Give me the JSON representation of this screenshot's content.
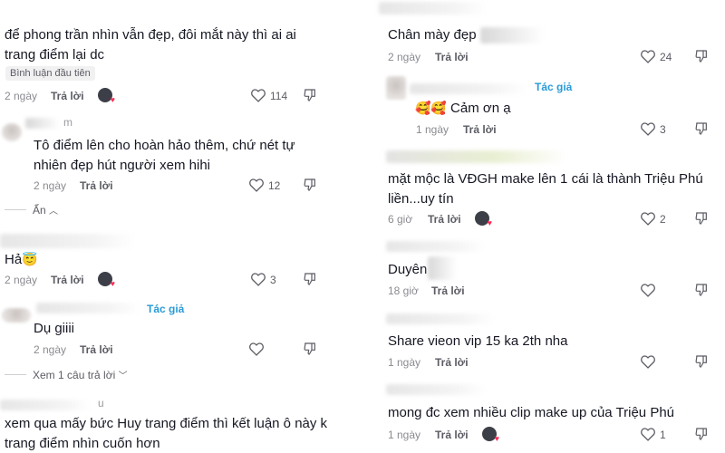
{
  "left": {
    "c1": {
      "text": "để phong trần nhìn vẫn đẹp, đôi mắt này thì ai ai trang điểm lại dc",
      "badge": "Bình luận đầu tiên",
      "time": "2 ngày",
      "reply": "Trả lời",
      "likes": "114"
    },
    "c2": {
      "user_tail": "m",
      "text": "Tô điểm lên cho hoàn hảo thêm, chứ nét tự nhiên đẹp hút người xem hihi",
      "time": "2 ngày",
      "reply": "Trả lời",
      "likes": "12",
      "hide": "Ẩn"
    },
    "c3": {
      "text": "Hả",
      "emoji": "😇",
      "time": "2 ngày",
      "reply": "Trả lời",
      "likes": "3"
    },
    "c4": {
      "author": "Tác giả",
      "text": "Dụ giiii",
      "time": "2 ngày",
      "reply": "Trả lời",
      "view_replies": "Xem 1 câu trả lời"
    },
    "c5": {
      "user_tail": "u",
      "text": "xem qua mấy bức Huy trang điểm thì kết luận ô này k trang điểm nhìn cuốn hơn"
    }
  },
  "right": {
    "c1": {
      "text": "Chân mày đẹp",
      "time": "2 ngày",
      "reply": "Trả lời",
      "likes": "24"
    },
    "c2": {
      "author": "Tác giả",
      "emoji": "🥰🥰",
      "text": "Cảm ơn ạ",
      "time": "1 ngày",
      "reply": "Trả lời",
      "likes": "3"
    },
    "c3": {
      "text": "mặt mộc là VĐGH make lên 1 cái là thành Triệu Phú liền...uy tín",
      "time": "6 giờ",
      "reply": "Trả lời",
      "likes": "2"
    },
    "c4": {
      "text": "Duyên",
      "time": "18 giờ",
      "reply": "Trả lời"
    },
    "c5": {
      "text": "Share vieon vip 15 ka 2th nha",
      "time": "1 ngày",
      "reply": "Trả lời"
    },
    "c6": {
      "text": "mong đc xem nhiều clip make up của Triệu Phú",
      "time": "1 ngày",
      "reply": "Trả lời",
      "likes": "1"
    }
  },
  "icons": {
    "like": "heart-outline-icon",
    "dislike": "thumbs-down-outline-icon",
    "chevron": "chevron-icon"
  },
  "colors": {
    "author_tag": "#2a9bd6",
    "text": "#161823",
    "meta": "#8a8b91",
    "creator_heart": "#fe2c55"
  }
}
